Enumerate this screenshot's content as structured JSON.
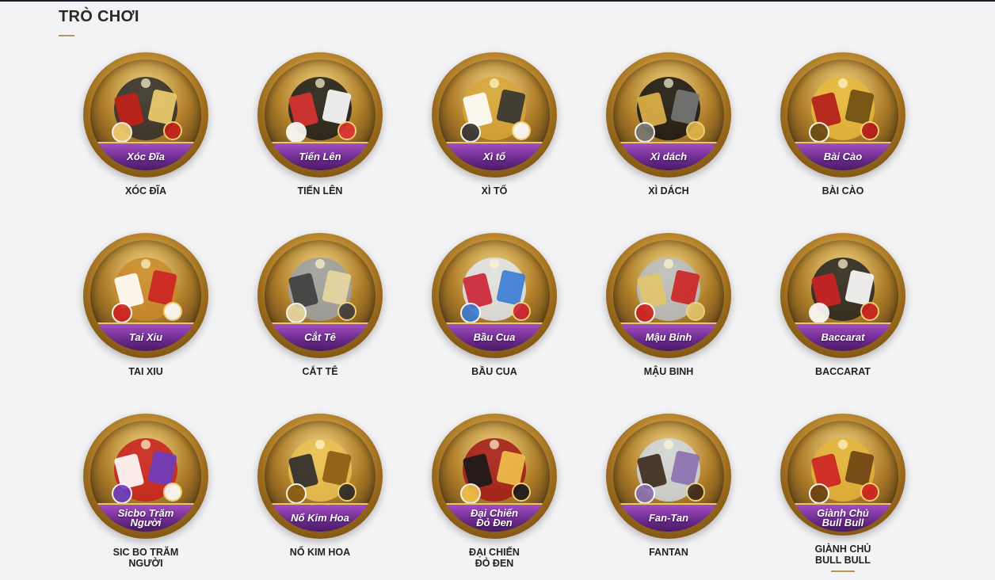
{
  "section": {
    "title": "TRÒ CHƠI"
  },
  "games": [
    {
      "ribbon": [
        "Xóc Đĩa"
      ],
      "label": [
        "XÓC ĐĨA"
      ],
      "icon": "dice-cup-icon"
    },
    {
      "ribbon": [
        "Tiến Lên"
      ],
      "label": [
        "TIẾN LÊN"
      ],
      "icon": "bomb-cards-icon"
    },
    {
      "ribbon": [
        "Xì tố"
      ],
      "label": [
        "XÌ TỐ"
      ],
      "icon": "crown-cards-icon"
    },
    {
      "ribbon": [
        "Xì dách"
      ],
      "label": [
        "XÌ DÁCH"
      ],
      "icon": "top-hat-coins-icon"
    },
    {
      "ribbon": [
        "Bài Cào"
      ],
      "label": [
        "BÀI CÀO"
      ],
      "icon": "gold-toad-icon"
    },
    {
      "ribbon": [
        "Tai Xiu"
      ],
      "label": [
        "TAI XIU"
      ],
      "icon": "gold-cup-dice-icon"
    },
    {
      "ribbon": [
        "Cắt Tê"
      ],
      "label": [
        "CẮT TÊ"
      ],
      "icon": "cat-king-icon"
    },
    {
      "ribbon": [
        "Bầu Cua"
      ],
      "label": [
        "BẦU CUA"
      ],
      "icon": "crystal-dice-icon"
    },
    {
      "ribbon": [
        "Mậu Binh"
      ],
      "label": [
        "MẬU BINH"
      ],
      "icon": "revolver-icon"
    },
    {
      "ribbon": [
        "Baccarat"
      ],
      "label": [
        "BACCARAT"
      ],
      "icon": "playing-cards-icon"
    },
    {
      "ribbon": [
        "Sicbo Trăm",
        "Người"
      ],
      "label": [
        "SIC BO TRĂM",
        "NGƯỜI"
      ],
      "icon": "red-dice-icon"
    },
    {
      "ribbon": [
        "Nổ Kim Hoa"
      ],
      "label": [
        "NỔ KIM HOA"
      ],
      "icon": "gold-rose-icon"
    },
    {
      "ribbon": [
        "Đại Chiến",
        "Đỏ Đen"
      ],
      "label": [
        "ĐẠI CHIẾN",
        "ĐỎ ĐEN"
      ],
      "icon": "versus-cards-icon"
    },
    {
      "ribbon": [
        "Fan-Tan"
      ],
      "label": [
        "FANTAN"
      ],
      "icon": "glass-dome-icon"
    },
    {
      "ribbon": [
        "Giành Chủ",
        "Bull Bull"
      ],
      "label": [
        "GIÀNH CHỦ",
        "BULL BULL"
      ],
      "icon": "gold-bull-icon"
    }
  ],
  "active_game": "GIÀNH CHỦ BULL BULL",
  "colors": {
    "ribbon": "#6a2a8b",
    "gold": "#e4b04c",
    "accent": "#b8955a",
    "background": "#f3f3f5"
  }
}
